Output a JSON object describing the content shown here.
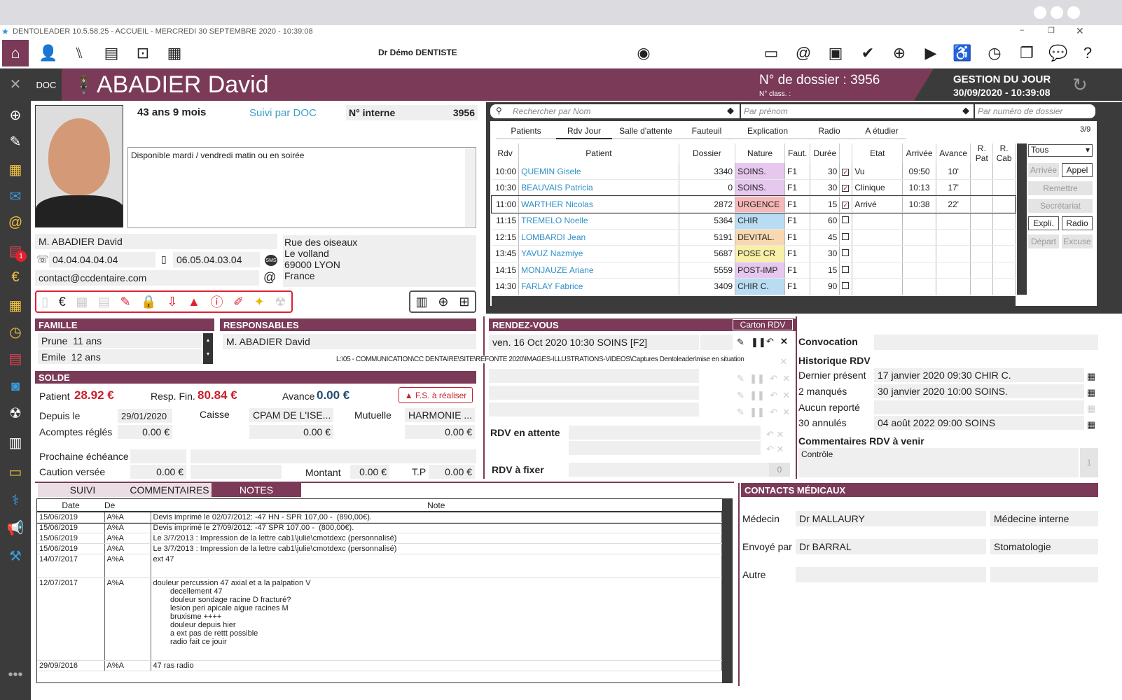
{
  "app": {
    "title": "DENTOLEADER 10.5.58.25 - ACCUEIL - MERCREDI 30 SEPTEMBRE 2020 - 10:39:08",
    "doctor": "Dr Démo DENTISTE"
  },
  "banner": {
    "doc": "DOC",
    "patient_name": "ABADIER David",
    "dossier": "N° de dossier : 3956",
    "class": "N° class. :",
    "gestion_title": "GESTION DU JOUR",
    "gestion_date": "30/09/2020 - 10:39:08"
  },
  "patient": {
    "age": "43 ans 9 mois",
    "suivi": "Suivi par DOC",
    "interne_label": "N° interne",
    "interne_value": "3956",
    "note": "Disponible mardi / vendredi matin ou en soirée",
    "full_name": "M. ABADIER David",
    "phone": "04.04.04.04.04",
    "mobile": "06.05.04.03.04",
    "email": "contact@ccdentaire.com",
    "addr1": "Rue des oiseaux",
    "addr2": "Le volland",
    "addr3": "69000 LYON",
    "addr4": "France",
    "sms": "SMS"
  },
  "search": {
    "name_placeholder": "Rechercher par Nom",
    "first_placeholder": "Par prénom",
    "num_placeholder": "Par numéro de dossier"
  },
  "rdv_tabs": [
    "Patients",
    "Rdv Jour",
    "Salle d'attente",
    "Fauteuil",
    "Explication",
    "Radio",
    "A étudier"
  ],
  "rdv_page": "3/9",
  "rdv_headers": [
    "Rdv",
    "Patient",
    "Dossier",
    "Nature",
    "Faut.",
    "Durée",
    "",
    "Etat",
    "Arrivée",
    "Avance",
    "R. Pat",
    "R. Cab"
  ],
  "rdv_rows": [
    {
      "time": "10:00",
      "name": "QUEMIN Gisele",
      "dossier": "3340",
      "nature": "SOINS.",
      "color": "#e6c8ee",
      "faut": "F1",
      "duree": "30",
      "checked": "✓",
      "etat": "Vu",
      "arrivee": "09:50",
      "avance": "10'"
    },
    {
      "time": "10:30",
      "name": "BEAUVAIS Patricia",
      "dossier": "0",
      "nature": "SOINS.",
      "color": "#e6c8ee",
      "faut": "F1",
      "duree": "30",
      "checked": "✓",
      "etat": "Clinique",
      "arrivee": "10:13",
      "avance": "17'"
    },
    {
      "time": "11:00",
      "name": "WARTHER Nicolas",
      "dossier": "2872",
      "nature": "URGENCE",
      "color": "#f6b8b8",
      "faut": "F1",
      "duree": "15",
      "checked": "✓",
      "etat": "Arrivé",
      "arrivee": "10:38",
      "avance": "22'"
    },
    {
      "time": "11:15",
      "name": "TREMELO Noelle",
      "dossier": "5364",
      "nature": "CHIR",
      "color": "#b9dcf2",
      "faut": "F1",
      "duree": "60",
      "checked": "",
      "etat": "",
      "arrivee": "",
      "avance": ""
    },
    {
      "time": "12:15",
      "name": "LOMBARDI Jean",
      "dossier": "5191",
      "nature": "DEVITAL.",
      "color": "#f8d8b0",
      "faut": "F1",
      "duree": "45",
      "checked": "",
      "etat": "",
      "arrivee": "",
      "avance": ""
    },
    {
      "time": "13:45",
      "name": "YAVUZ Nazmiye",
      "dossier": "5687",
      "nature": "POSE CR",
      "color": "#f8f0a8",
      "faut": "F1",
      "duree": "30",
      "checked": "",
      "etat": "",
      "arrivee": "",
      "avance": ""
    },
    {
      "time": "14:15",
      "name": "MONJAUZE Ariane",
      "dossier": "5559",
      "nature": "POST-IMP",
      "color": "#e6c8ee",
      "faut": "F1",
      "duree": "15",
      "checked": "",
      "etat": "",
      "arrivee": "",
      "avance": ""
    },
    {
      "time": "14:30",
      "name": "FARLAY Fabrice",
      "dossier": "3409",
      "nature": "CHIR C.",
      "color": "#b9dcf2",
      "faut": "F1",
      "duree": "90",
      "checked": "",
      "etat": "",
      "arrivee": "",
      "avance": ""
    }
  ],
  "rdv_side": {
    "filter": "Tous",
    "arrivee": "Arrivée",
    "appel": "Appel",
    "remettre": "Remettre",
    "secretariat": "Secrétariat",
    "expli": "Expli.",
    "radio": "Radio",
    "depart": "Départ",
    "excuse": "Excuse"
  },
  "famille": {
    "header": "FAMILLE",
    "members": [
      {
        "name": "Prune",
        "age": "11 ans"
      },
      {
        "name": "Emile",
        "age": "12 ans"
      }
    ]
  },
  "responsables": {
    "header": "RESPONSABLES",
    "name": "M. ABADIER David",
    "path": "L:\\05 - COMMUNICATION\\CC DENTAIRE\\SITE\\REFONTE 2020\\IMAGES-ILLUSTRATIONS-VIDEOS\\Captures Dentoleader\\mise en situation"
  },
  "solde": {
    "header": "SOLDE",
    "patient_label": "Patient",
    "patient_value": "28.92 €",
    "resp_label": "Resp. Fin.",
    "resp_value": "80.84 €",
    "avance_label": "Avance",
    "avance_value": "0.00 €",
    "fs_label": "F.S. à réaliser",
    "depuis_label": "Depuis le",
    "depuis_value": "29/01/2020",
    "caisse_label": "Caisse",
    "caisse_value": "CPAM DE L'ISE...",
    "mutuelle_label": "Mutuelle",
    "mutuelle_value": "HARMONIE ...",
    "acomptes_label": "Acomptes réglés",
    "acompte1": "0.00 €",
    "acompte2": "0.00 €",
    "acompte3": "0.00 €",
    "echeance_label": "Prochaine échéance",
    "caution_label": "Caution versée",
    "caution_value": "0.00 €",
    "montant_label": "Montant",
    "montant_value": "0.00 €",
    "tp_label": "T.P",
    "tp_value": "0.00 €"
  },
  "rendezvous": {
    "header": "RENDEZ-VOUS",
    "carton": "Carton RDV",
    "next": "ven. 16 Oct 2020 10:30 SOINS [F2]",
    "convocation": "Convocation",
    "historique": "Historique RDV",
    "dernier_label": "Dernier présent",
    "dernier_value": "17 janvier 2020 09:30 CHIR C.",
    "manques_label": "2 manqués",
    "manques_value": "30 janvier 2020 10:00 SOINS.",
    "reporte_label": "Aucun reporté",
    "annules_label": "30 annulés",
    "annules_value": "04 août 2022 09:00 SOINS",
    "attente_label": "RDV en attente",
    "fixer_label": "RDV à fixer",
    "fixer_count": "0",
    "comment_label": "Commentaires RDV à venir",
    "comment_value": "Contrôle",
    "comment_count": "1"
  },
  "notes": {
    "tabs": [
      "SUIVI",
      "COMMENTAIRES",
      "NOTES"
    ],
    "headers": [
      "Date",
      "De",
      "Note"
    ],
    "rows": [
      {
        "date": "15/06/2019",
        "de": "A%A",
        "note": "Devis imprimé le 02/07/2012: -47 HN - SPR 107,00 -  (890,00€)."
      },
      {
        "date": "15/06/2019",
        "de": "A%A",
        "note": "Devis imprimé le 27/09/2012: -47 SPR 107,00 -  (800,00€)."
      },
      {
        "date": "15/06/2019",
        "de": "A%A",
        "note": "Le 3/7/2013 : Impression de la lettre cab1\\julie\\cmotdexc (personnalisé)"
      },
      {
        "date": "15/06/2019",
        "de": "A%A",
        "note": "Le 3/7/2013 : Impression de la lettre cab1\\julie\\cmotdexc (personnalisé)"
      },
      {
        "date": "14/07/2017",
        "de": "A%A",
        "note": "ext 47"
      },
      {
        "date": "12/07/2017",
        "de": "A%A",
        "note": "douleur percussion 47 axial et a la palpation V\n        decellement 47\n        douleur sondage racine D fracturé?\n        lesion peri apicale aigue racines M\n        bruxisme ++++\n        douleur depuis hier\n        a ext pas de rettt possible\n        radio fait ce jouir"
      },
      {
        "date": "29/09/2016",
        "de": "A%A",
        "note": "47 ras radio"
      }
    ]
  },
  "contacts": {
    "header": "CONTACTS MÉDICAUX",
    "medecin_label": "Médecin",
    "medecin_value": "Dr MALLAURY",
    "medecin_spec": "Médecine interne",
    "envoye_label": "Envoyé par",
    "envoye_value": "Dr BARRAL",
    "envoye_spec": "Stomatologie",
    "autre_label": "Autre"
  }
}
